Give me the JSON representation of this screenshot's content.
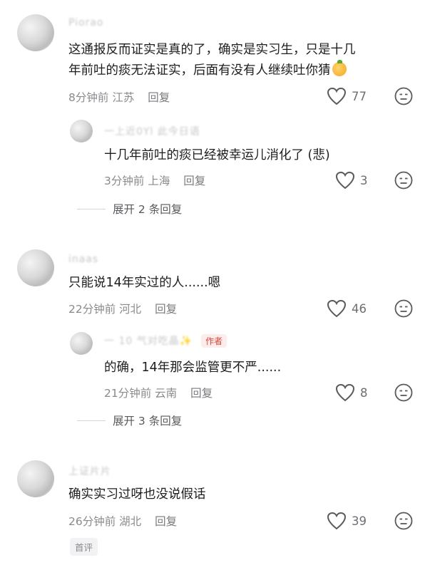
{
  "comments": [
    {
      "user": "Piorao",
      "text_lines": [
        "这通报反而证实是真的了，确实是实习生，只是十几",
        "年前吐的痰无法证实，后面有没有人继续吐你猜"
      ],
      "time": "8分钟前",
      "location": "江苏",
      "reply_label": "回复",
      "likes": "77",
      "replies": [
        {
          "user": "一上近0Yl 此今日语",
          "text": "十几年前吐的痰已经被幸运儿消化了 (悲)",
          "time": "3分钟前",
          "location": "上海",
          "reply_label": "回复",
          "likes": "3"
        }
      ],
      "expand_label": "展开 2 条回复"
    },
    {
      "user": "inaas",
      "text_lines": [
        "只能说14年实过的人......嗯"
      ],
      "time": "22分钟前",
      "location": "河北",
      "reply_label": "回复",
      "likes": "46",
      "replies": [
        {
          "user": "一 10 气对吃晶✨",
          "author_tag": "作者",
          "text": "的确，14年那会监管更不严......",
          "time": "21分钟前",
          "location": "云南",
          "reply_label": "回复",
          "likes": "8"
        }
      ],
      "expand_label": "展开 3 条回复"
    },
    {
      "user": "上证片片",
      "text_lines": [
        "确实实习过呀也没说假话"
      ],
      "time": "26分钟前",
      "location": "湖北",
      "reply_label": "回复",
      "likes": "39",
      "badge": "首评"
    }
  ],
  "icons": {
    "like": "heart-outline-icon",
    "dislike": "neutral-face-icon",
    "emoji": "orange-emoji-icon"
  },
  "colors": {
    "author_tag": "#e0453a",
    "meta": "#8a8a8e",
    "text": "#1d1d1f"
  }
}
